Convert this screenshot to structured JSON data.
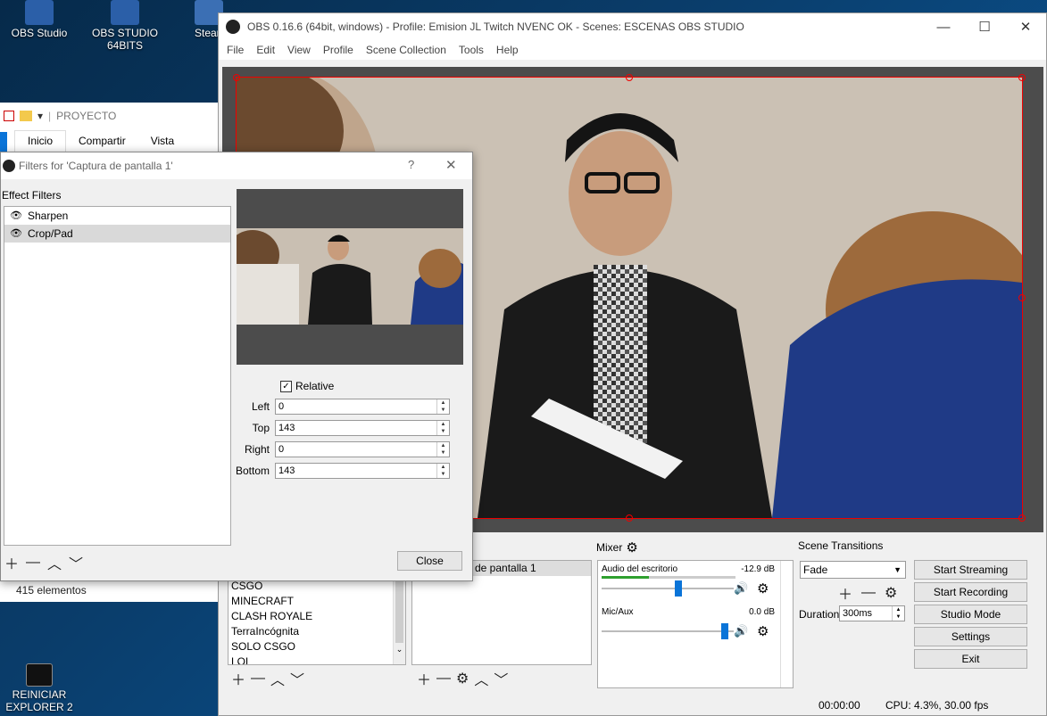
{
  "desktop": {
    "icons": [
      {
        "label": "OBS Studio"
      },
      {
        "label": "OBS STUDIO 64BITS"
      },
      {
        "label": "Stear"
      },
      {
        "label": "REINICIAR EXPLORER 2"
      }
    ]
  },
  "explorer": {
    "title": "PROYECTO",
    "tabs": [
      "Inicio",
      "Compartir",
      "Vista"
    ],
    "status": "415 elementos"
  },
  "obs": {
    "title": "OBS 0.16.6 (64bit, windows) - Profile: Emision JL Twitch NVENC OK - Scenes: ESCENAS OBS STUDIO",
    "menu": [
      "File",
      "Edit",
      "View",
      "Profile",
      "Scene Collection",
      "Tools",
      "Help"
    ],
    "scenes": [
      "CSGO",
      "MINECRAFT",
      "CLASH ROYALE",
      "TerraIncógnita",
      "SOLO CSGO",
      "LOL"
    ],
    "source_selected": "de pantalla 1",
    "mixer": {
      "label": "Mixer",
      "channels": [
        {
          "name": "Audio del escritorio",
          "db": "-12.9 dB",
          "level": 0.7
        },
        {
          "name": "Mic/Aux",
          "db": "0.0 dB",
          "level": 0.98
        }
      ]
    },
    "transitions": {
      "label": "Scene Transitions",
      "selected": "Fade",
      "duration_label": "Duration",
      "duration_value": "300ms"
    },
    "controls": [
      "Start Streaming",
      "Start Recording",
      "Studio Mode",
      "Settings",
      "Exit"
    ],
    "status": {
      "time": "00:00:00",
      "cpu": "CPU: 4.3%, 30.00 fps"
    }
  },
  "filters_dialog": {
    "title": "Filters for 'Captura de pantalla 1'",
    "help": "?",
    "effect_label": "Effect Filters",
    "filters": [
      "Sharpen",
      "Crop/Pad"
    ],
    "relative_label": "Relative",
    "fields": [
      {
        "label": "Left",
        "value": "0"
      },
      {
        "label": "Top",
        "value": "143"
      },
      {
        "label": "Right",
        "value": "0"
      },
      {
        "label": "Bottom",
        "value": "143"
      }
    ],
    "close_label": "Close"
  },
  "colors": {
    "selection_red": "#e00000",
    "accent_blue": "#0a74d8",
    "meter_green": "#2ea02e"
  }
}
